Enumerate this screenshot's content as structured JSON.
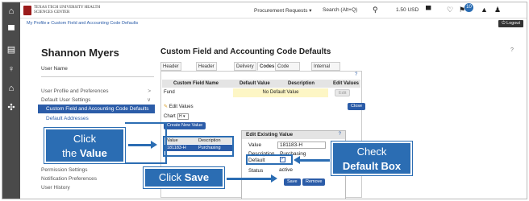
{
  "header": {
    "university_name": "TEXAS TECH UNIVERSITY HEALTH SCIENCES CENTER",
    "procurement_menu": "Procurement Requests ▾",
    "search_label": "Search (Alt+Q)",
    "cart_amount": "1.50 USD",
    "notification_count": "10",
    "logout_label": "Logout"
  },
  "breadcrumb": {
    "text": "My Profile ▸ Custom Field and Accounting Code Defaults"
  },
  "profile": {
    "name": "Shannon Myers",
    "user_name_label": "User Name"
  },
  "sidebar": {
    "items": [
      {
        "label": "User Profile and Preferences",
        "arrow": ">"
      },
      {
        "label": "Default User Settings",
        "arrow": "∨"
      },
      {
        "label": "Custom Field and Accounting Code Defaults",
        "arrow": ""
      },
      {
        "label": "Default Addresses",
        "arrow": ""
      },
      {
        "label": "Permission Settings",
        "arrow": ">"
      },
      {
        "label": "Notification Preferences",
        "arrow": ">"
      },
      {
        "label": "User History",
        "arrow": ">"
      }
    ]
  },
  "main": {
    "title": "Custom Field and Accounting Code Defaults",
    "help": "?",
    "tabs": [
      {
        "label": "Header (int.)"
      },
      {
        "label": "Header (ext.)"
      },
      {
        "label": "Delivery"
      },
      {
        "label": "Codes"
      },
      {
        "label": "Code Favorites"
      },
      {
        "label": "Internal Information"
      }
    ],
    "table": {
      "headers": [
        "Custom Field Name",
        "Default Value",
        "Description",
        "Edit Values"
      ],
      "row": {
        "field": "Fund",
        "default_value": "No Default Value",
        "edit_label": "Edit"
      }
    },
    "edit_values_label": "Edit Values",
    "close_label": "Close",
    "chart_label": "Chart",
    "chart_value": "H",
    "create_new_value_label": "Create New Value",
    "value_list": {
      "headers": [
        "Value",
        "Description"
      ],
      "row": {
        "value": "181183-H",
        "description": "Purchasing"
      }
    },
    "edit_existing": {
      "title": "Edit Existing Value",
      "help": "?",
      "value_label": "Value",
      "value": "181183-H",
      "description_label": "Description",
      "description": "Purchasing",
      "default_label": "Default",
      "default_checked": "✓",
      "status_label": "Status",
      "status": "active",
      "save_label": "Save",
      "remove_label": "Remove"
    }
  },
  "callouts": {
    "click_value_line1": "Click",
    "click_value_line2a": "the ",
    "click_value_line2b": "Value",
    "click_save_a": "Click ",
    "click_save_b": "Save",
    "check_default_line1": "Check",
    "check_default_line2": "Default Box"
  },
  "colors": {
    "accent_blue": "#2b6db3",
    "nav_dark": "#4a4a4a",
    "highlight_yellow": "#fdf6c5"
  }
}
